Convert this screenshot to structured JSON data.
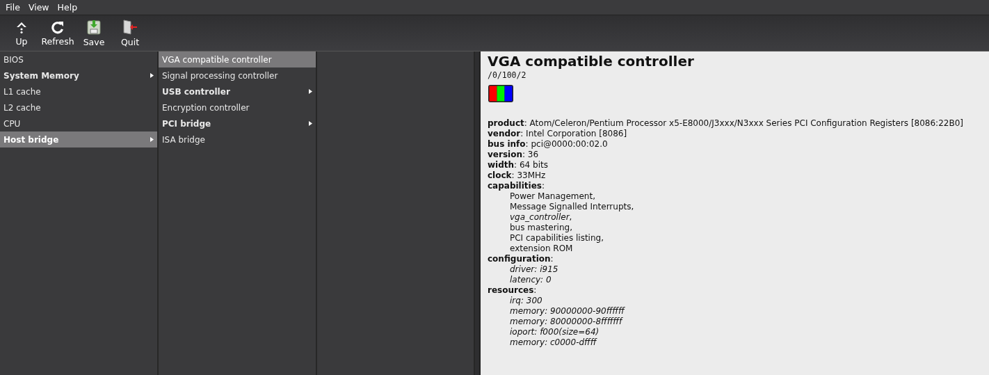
{
  "menu": [
    "File",
    "View",
    "Help"
  ],
  "toolbar": [
    {
      "label": "Up",
      "kind": "up"
    },
    {
      "label": "Refresh",
      "kind": "refresh"
    },
    {
      "label": "Save",
      "kind": "save"
    },
    {
      "label": "Quit",
      "kind": "quit"
    }
  ],
  "columns": [
    {
      "items": [
        {
          "label": "BIOS",
          "has_children": false,
          "selected": false
        },
        {
          "label": "System Memory",
          "has_children": true,
          "selected": false
        },
        {
          "label": "L1 cache",
          "has_children": false,
          "selected": false
        },
        {
          "label": "L2 cache",
          "has_children": false,
          "selected": false
        },
        {
          "label": "CPU",
          "has_children": false,
          "selected": false
        },
        {
          "label": "Host bridge",
          "has_children": true,
          "selected": true
        }
      ]
    },
    {
      "items": [
        {
          "label": "VGA compatible controller",
          "has_children": false,
          "selected": true
        },
        {
          "label": "Signal processing controller",
          "has_children": false,
          "selected": false
        },
        {
          "label": "USB controller",
          "has_children": true,
          "selected": false
        },
        {
          "label": "Encryption controller",
          "has_children": false,
          "selected": false
        },
        {
          "label": "PCI bridge",
          "has_children": true,
          "selected": false
        },
        {
          "label": "ISA bridge",
          "has_children": false,
          "selected": false
        }
      ]
    },
    {}
  ],
  "detail": {
    "title": "VGA compatible controller",
    "path": "/0/100/2",
    "fields": [
      {
        "text": "**product**: Atom/Celeron/Pentium Processor x5-E8000/J3xxx/N3xxx Series PCI Configuration Registers [8086:22B0]"
      },
      {
        "text": "**vendor**: Intel Corporation [8086]"
      },
      {
        "text": "**bus info**: pci@0000:00:02.0"
      },
      {
        "text": "**version**: 36"
      },
      {
        "text": "**width**: 64 bits"
      },
      {
        "text": "**clock**: 33MHz"
      },
      {
        "text": "**capabilities**:",
        "lines": [
          {
            "text": "Power Management,",
            "italic": false
          },
          {
            "text": "Message Signalled Interrupts,",
            "italic": false
          },
          {
            "text": "*vga_controller*,",
            "italic": false
          },
          {
            "text": "bus mastering,",
            "italic": false
          },
          {
            "text": "PCI capabilities listing,",
            "italic": false
          },
          {
            "text": "extension ROM",
            "italic": false
          }
        ]
      },
      {
        "text": "**configuration**:",
        "lines": [
          {
            "text": "driver: i915",
            "italic": true
          },
          {
            "text": "latency: 0",
            "italic": true
          }
        ]
      },
      {
        "text": "**resources**:",
        "lines": [
          {
            "text": "irq: 300",
            "italic": true
          },
          {
            "text": "memory: 90000000-90ffffff",
            "italic": true
          },
          {
            "text": "memory: 80000000-8fffffff",
            "italic": true
          },
          {
            "text": "ioport: f000(size=64)",
            "italic": true
          },
          {
            "text": "memory: c0000-dffff",
            "italic": true
          }
        ]
      }
    ]
  }
}
